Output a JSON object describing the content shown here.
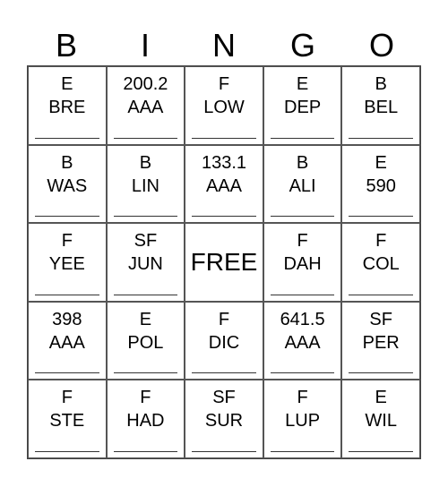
{
  "header": [
    "B",
    "I",
    "N",
    "G",
    "O"
  ],
  "cells": [
    {
      "line1": "E",
      "line2": "BRE"
    },
    {
      "line1": "200.2",
      "line2": "AAA"
    },
    {
      "line1": "F",
      "line2": "LOW"
    },
    {
      "line1": "E",
      "line2": "DEP"
    },
    {
      "line1": "B",
      "line2": "BEL"
    },
    {
      "line1": "B",
      "line2": "WAS"
    },
    {
      "line1": "B",
      "line2": "LIN"
    },
    {
      "line1": "133.1",
      "line2": "AAA"
    },
    {
      "line1": "B",
      "line2": "ALI"
    },
    {
      "line1": "E",
      "line2": "590"
    },
    {
      "line1": "F",
      "line2": "YEE"
    },
    {
      "line1": "SF",
      "line2": "JUN"
    },
    {
      "free": "FREE"
    },
    {
      "line1": "F",
      "line2": "DAH"
    },
    {
      "line1": "F",
      "line2": "COL"
    },
    {
      "line1": "398",
      "line2": "AAA"
    },
    {
      "line1": "E",
      "line2": "POL"
    },
    {
      "line1": "F",
      "line2": "DIC"
    },
    {
      "line1": "641.5",
      "line2": "AAA"
    },
    {
      "line1": "SF",
      "line2": "PER"
    },
    {
      "line1": "F",
      "line2": "STE"
    },
    {
      "line1": "F",
      "line2": "HAD"
    },
    {
      "line1": "SF",
      "line2": "SUR"
    },
    {
      "line1": "F",
      "line2": "LUP"
    },
    {
      "line1": "E",
      "line2": "WIL"
    }
  ]
}
